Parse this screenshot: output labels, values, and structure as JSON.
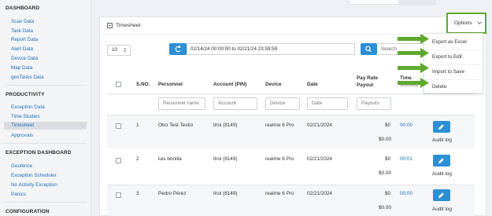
{
  "sidebar": {
    "sections": [
      {
        "title": "DASHBOARD",
        "items": [
          "Scan Data",
          "Task Data",
          "Report Data",
          "Alert Data",
          "Device Data",
          "Map Data",
          "geoTasks Data"
        ]
      },
      {
        "title": "PRODUCTIVITY",
        "items": [
          "Exception Data",
          "Time Studies",
          "Timesheet",
          "Approvals"
        ],
        "active": "Timesheet"
      },
      {
        "title": "EXCEPTION DASHBOARD",
        "items": [
          "Geofence",
          "Exception Scheduler",
          "No Activity Exception",
          "Panics"
        ]
      },
      {
        "title": "CONFIGURATION",
        "items": []
      }
    ]
  },
  "panel": {
    "title": "Timesheet"
  },
  "options": {
    "label": "Options",
    "menu": [
      "Export as Excel",
      "Export to Edit",
      "Import to Save",
      "Delete"
    ]
  },
  "controls": {
    "page_size": "10",
    "date_range": "02/14/24 00:00:00 to 02/21/24 23:59:59",
    "search_placeholder": "Search"
  },
  "table": {
    "headers": {
      "sno": "S.NO.",
      "personnel": "Personnel",
      "account": "Account (PIN)",
      "device": "Device",
      "date": "Date",
      "payout_l1": "Pay Rate",
      "payout_l2": "Payout",
      "time_l1": "Time",
      "time_l2": "Worked"
    },
    "filters": {
      "personnel": "Personnel name",
      "account": "Account",
      "device": "Device",
      "date": "Date",
      "payouts": "Payouts"
    },
    "rows": [
      {
        "sno": "1",
        "personnel": "Otro Test Testio",
        "account": "itroi (8149)",
        "device": "realme 6 Pro",
        "date": "02/21/2024",
        "rate": "$0",
        "payout": "$0.00",
        "time": "00:00",
        "audit": "Audit log"
      },
      {
        "sno": "2",
        "personnel": "luis bonilla",
        "account": "itroi (8149)",
        "device": "realme 6 Pro",
        "date": "02/21/2024",
        "rate": "$0",
        "payout": "$0.00",
        "time": "00:01",
        "audit": "Audit log"
      },
      {
        "sno": "3",
        "personnel": "Pedro Pérez",
        "account": "itroi (8149)",
        "device": "realme 6 Pro",
        "date": "02/21/2024",
        "rate": "$0",
        "payout": "$0.00",
        "time": "00:00",
        "audit": "Audit log"
      }
    ]
  },
  "colors": {
    "accent": "#2d8fd4",
    "highlight": "#5fa82e",
    "link": "#1f6fb8"
  }
}
